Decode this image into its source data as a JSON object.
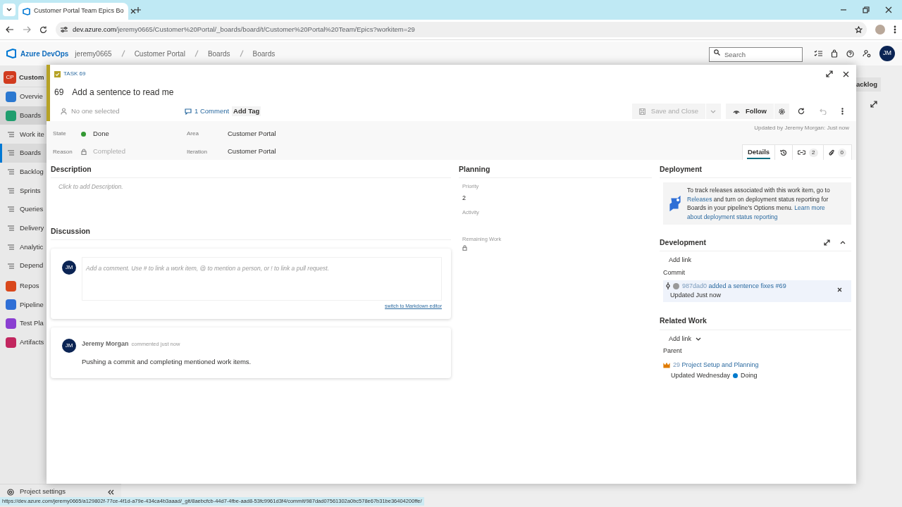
{
  "browser": {
    "tab_title": "Customer Portal Team Epics Bo",
    "url_host": "dev.azure.com",
    "url_path": "/jeremy0665/Customer%20Portal/_boards/board/t/Customer%20Portal%20Team/Epics?workitem=29"
  },
  "header": {
    "product": "Azure DevOps",
    "breadcrumbs": [
      "jeremy0665",
      "Customer Portal",
      "Boards",
      "Boards"
    ],
    "search": {
      "placeholder": "Search"
    },
    "avatar": "JM"
  },
  "sidebar": {
    "project_badge": "CP",
    "project": "Custom",
    "items": [
      {
        "label": "Overvie",
        "kind": "hub",
        "color": "#2b78d0",
        "selected": false
      },
      {
        "label": "Boards",
        "kind": "hub",
        "color": "#1f9e6e",
        "selected": true
      },
      {
        "label": "Work ite",
        "kind": "sub",
        "selected": false
      },
      {
        "label": "Boards",
        "kind": "sub",
        "selected": true
      },
      {
        "label": "Backlog",
        "kind": "sub",
        "selected": false
      },
      {
        "label": "Sprints",
        "kind": "sub",
        "selected": false
      },
      {
        "label": "Queries",
        "kind": "sub",
        "selected": false
      },
      {
        "label": "Delivery",
        "kind": "sub",
        "selected": false
      },
      {
        "label": "Analytic",
        "kind": "sub",
        "selected": false
      },
      {
        "label": "Depend",
        "kind": "sub",
        "selected": false
      },
      {
        "label": "Repos",
        "kind": "hub",
        "color": "#d9481c",
        "selected": false
      },
      {
        "label": "Pipeline",
        "kind": "hub",
        "color": "#2f6fd6",
        "selected": false
      },
      {
        "label": "Test Pla",
        "kind": "hub",
        "color": "#8a3fd1",
        "selected": false
      },
      {
        "label": "Artifacts",
        "kind": "hub",
        "color": "#c2275f",
        "selected": false
      }
    ],
    "settings": "Project settings"
  },
  "background": {
    "button": "acklog"
  },
  "work_item": {
    "type": "TASK 69",
    "id": "69",
    "title": "Add a sentence to read me",
    "assignee": "No one selected",
    "comments": "1 Comment",
    "add_tag": "Add Tag",
    "save": {
      "label": "Save and Close",
      "disabled": true
    },
    "follow": "Follow",
    "updated": "Updated by Jeremy Morgan: Just now",
    "fields": [
      {
        "label": "State",
        "value": "Done",
        "kind": "state",
        "color": "#339933"
      },
      {
        "label": "Reason",
        "value": "Completed",
        "kind": "locked"
      },
      {
        "label": "Area",
        "value": "Customer Portal",
        "kind": "text"
      },
      {
        "label": "Iteration",
        "value": "Customer Portal",
        "kind": "text"
      }
    ],
    "tabs": [
      {
        "kind": "text",
        "label": "Details",
        "selected": true
      },
      {
        "kind": "history",
        "selected": false
      },
      {
        "kind": "links",
        "count": "2",
        "selected": false
      },
      {
        "kind": "attachments",
        "count": "0",
        "selected": false
      }
    ],
    "description": {
      "heading": "Description",
      "placeholder": "Click to add Description."
    },
    "discussion": {
      "heading": "Discussion",
      "avatar": "JM",
      "placeholder": "Add a comment. Use # to link a work item, @ to mention a person, or ! to link a pull request.",
      "markdown_link": "switch to Markdown editor",
      "comments": [
        {
          "avatar": "JM",
          "author": "Jeremy Morgan",
          "meta": "commented just now",
          "text": "Pushing a commit and completing mentioned work items."
        }
      ]
    },
    "planning": {
      "heading": "Planning",
      "fields": [
        {
          "label": "Priority",
          "kind": "text",
          "value": "2"
        },
        {
          "label": "Activity",
          "kind": "empty"
        },
        {
          "label": "Remaining Work",
          "kind": "locked"
        }
      ]
    },
    "deployment": {
      "heading": "Deployment",
      "parts": [
        {
          "text": "To track releases associated with this work item, go to",
          "link": false
        },
        {
          "text": "Releases",
          "link": true
        },
        {
          "text": "and turn on deployment status reporting for",
          "link": false
        },
        {
          "text": "Boards in your pipeline's Options menu.",
          "link": false
        },
        {
          "text": "Learn more",
          "link": true
        },
        {
          "text": "about deployment status reporting",
          "link": true
        }
      ]
    },
    "development": {
      "heading": "Development",
      "add_link": "Add link",
      "group": "Commit",
      "item": {
        "hash": "987dad0",
        "message": "added a sentence fixes #69",
        "updated": "Updated Just now"
      }
    },
    "related_work": {
      "heading": "Related Work",
      "add_link": "Add link",
      "group": "Parent",
      "item": {
        "id": "29",
        "title": "Project Setup and Planning",
        "updated": "Updated Wednesday",
        "state": "Doing",
        "color": "#007acc"
      }
    }
  },
  "status_url": "https://dev.azure.com/jeremy0665/a129802f-77ce-4f1d-a79e-434ca4b3aaad/_git/8aebcfcb-44d7-4fbe-aad8-53fc9961d3f4/commit/987dad07561302a0bc578e67b31be36404200ffe/"
}
